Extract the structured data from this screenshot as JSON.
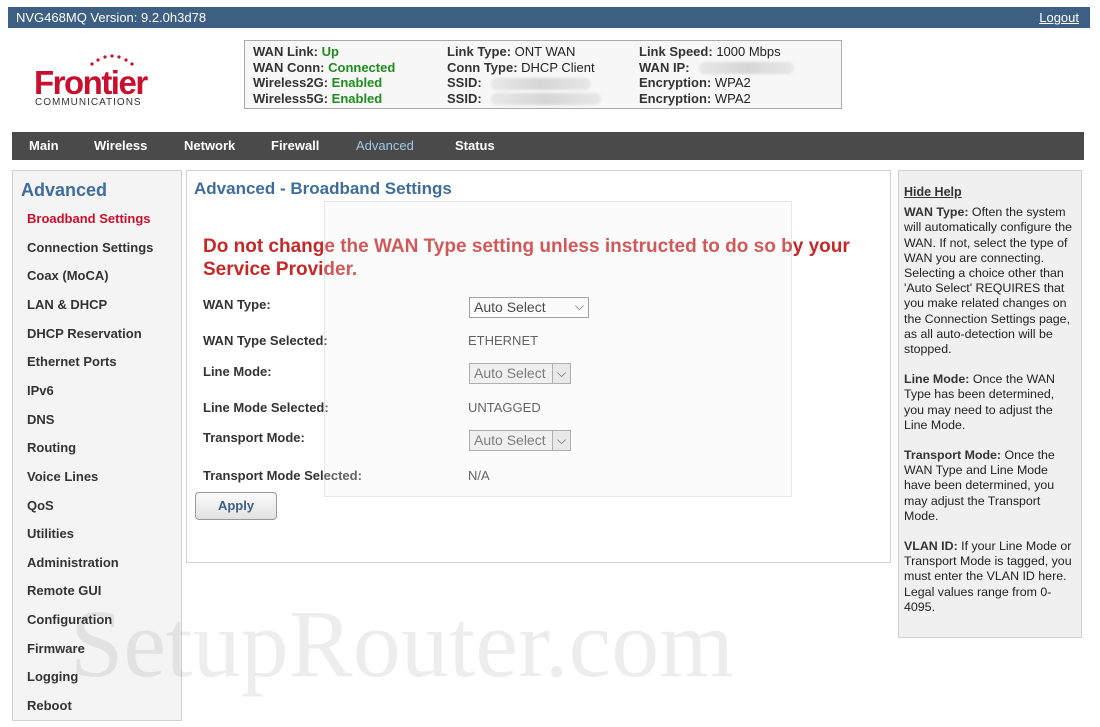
{
  "header": {
    "version": "NVG468MQ Version: 9.2.0h3d78",
    "logout": "Logout"
  },
  "logo": {
    "name": "Frontier",
    "subtitle": "COMMUNICATIONS"
  },
  "status": {
    "col1": [
      {
        "label": "WAN Link:",
        "value": "Up"
      },
      {
        "label": "WAN Conn:",
        "value": "Connected"
      },
      {
        "label": "Wireless2G:",
        "value": "Enabled"
      },
      {
        "label": "Wireless5G:",
        "value": "Enabled"
      }
    ],
    "col2": [
      {
        "label": "Link Type:",
        "value": "ONT WAN"
      },
      {
        "label": "Conn Type:",
        "value": "DHCP Client"
      },
      {
        "label": "SSID:",
        "value": ""
      },
      {
        "label": "SSID:",
        "value": ""
      }
    ],
    "col3": [
      {
        "label": "Link Speed:",
        "value": "1000 Mbps"
      },
      {
        "label": "WAN IP:",
        "value": ""
      },
      {
        "label": "Encryption:",
        "value": "WPA2"
      },
      {
        "label": "Encryption:",
        "value": "WPA2"
      }
    ]
  },
  "nav": [
    "Main",
    "Wireless",
    "Network",
    "Firewall",
    "Advanced",
    "Status"
  ],
  "sidebar": {
    "title": "Advanced",
    "items": [
      "Broadband Settings",
      "Connection Settings",
      "Coax (MoCA)",
      "LAN & DHCP",
      "DHCP Reservation",
      "Ethernet Ports",
      "IPv6",
      "DNS",
      "Routing",
      "Voice Lines",
      "QoS",
      "Utilities",
      "Administration",
      "Remote GUI",
      "Configuration",
      "Firmware",
      "Logging",
      "Reboot"
    ]
  },
  "main": {
    "title": "Advanced - Broadband Settings",
    "warning": "Do not change the WAN Type setting unless instructed to do so by your Service Provider.",
    "wan_type_label": "WAN Type:",
    "wan_type_value": "Auto Select",
    "wan_type_selected_label": "WAN Type Selected:",
    "wan_type_selected_value": "ETHERNET",
    "line_mode_label": "Line Mode:",
    "line_mode_value": "Auto Select",
    "line_mode_selected_label": "Line Mode Selected:",
    "line_mode_selected_value": "UNTAGGED",
    "transport_mode_label": "Transport Mode:",
    "transport_mode_value": "Auto Select",
    "transport_mode_selected_label": "Transport Mode Selected:",
    "transport_mode_selected_value": "N/A",
    "apply": "Apply"
  },
  "help": {
    "hide": "Hide Help",
    "sections": [
      {
        "term": "WAN Type:",
        "text": " Often the system will automatically configure the WAN. If not, select the type of WAN you are connecting. Selecting a choice other than 'Auto Select' REQUIRES that you make related changes on the Connection Settings page, as all auto-detection will be stopped."
      },
      {
        "term": "Line Mode:",
        "text": " Once the WAN Type has been determined, you may need to adjust the Line Mode."
      },
      {
        "term": "Transport Mode:",
        "text": " Once the WAN Type and Line Mode have been determined, you may adjust the Transport Mode."
      },
      {
        "term": "VLAN ID:",
        "text": " If your Line Mode or Transport Mode is tagged, you must enter the VLAN ID here. Legal values range from 0-4095."
      }
    ]
  },
  "watermark": "SetupRouter.com",
  "icons": {
    "dropdown": "chevron-down-icon"
  }
}
